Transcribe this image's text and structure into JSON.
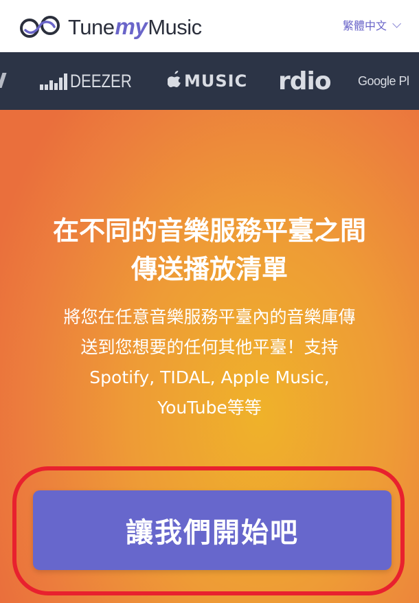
{
  "header": {
    "brand_prefix": "Tune",
    "brand_my": "my",
    "brand_suffix": "Music",
    "language_label": "繁體中文",
    "colors": {
      "brand_purple": "#6a65c9",
      "text_dark": "#2b2f3c"
    },
    "icons": {
      "logo": "tunemymusic-logo-icon",
      "language_dropdown": "chevron-down-icon"
    }
  },
  "services": {
    "items": [
      {
        "name": "DEEZER",
        "icon": "deezer-bars-icon"
      },
      {
        "name": "MUSIC",
        "icon": "apple-icon"
      },
      {
        "name": "rdio",
        "icon": ""
      },
      {
        "name": "Google Pl",
        "icon": ""
      }
    ],
    "background": "#2c3446"
  },
  "hero": {
    "title_lines": [
      "在不同的音樂服務平臺之間",
      "傳送播放清單"
    ],
    "subtitle_lines": [
      "將您在任意音樂服務平臺內的音樂庫傳",
      "送到您想要的任何其他平臺！支持",
      "Spotify, TIDAL, Apple Music,",
      "YouTube等等"
    ],
    "cta_label": "讓我們開始吧",
    "colors": {
      "cta_bg": "#6767cc",
      "highlight_ring": "#e8212e",
      "gradient_center": "#efb22a",
      "gradient_edge": "#ea6f3c"
    }
  }
}
